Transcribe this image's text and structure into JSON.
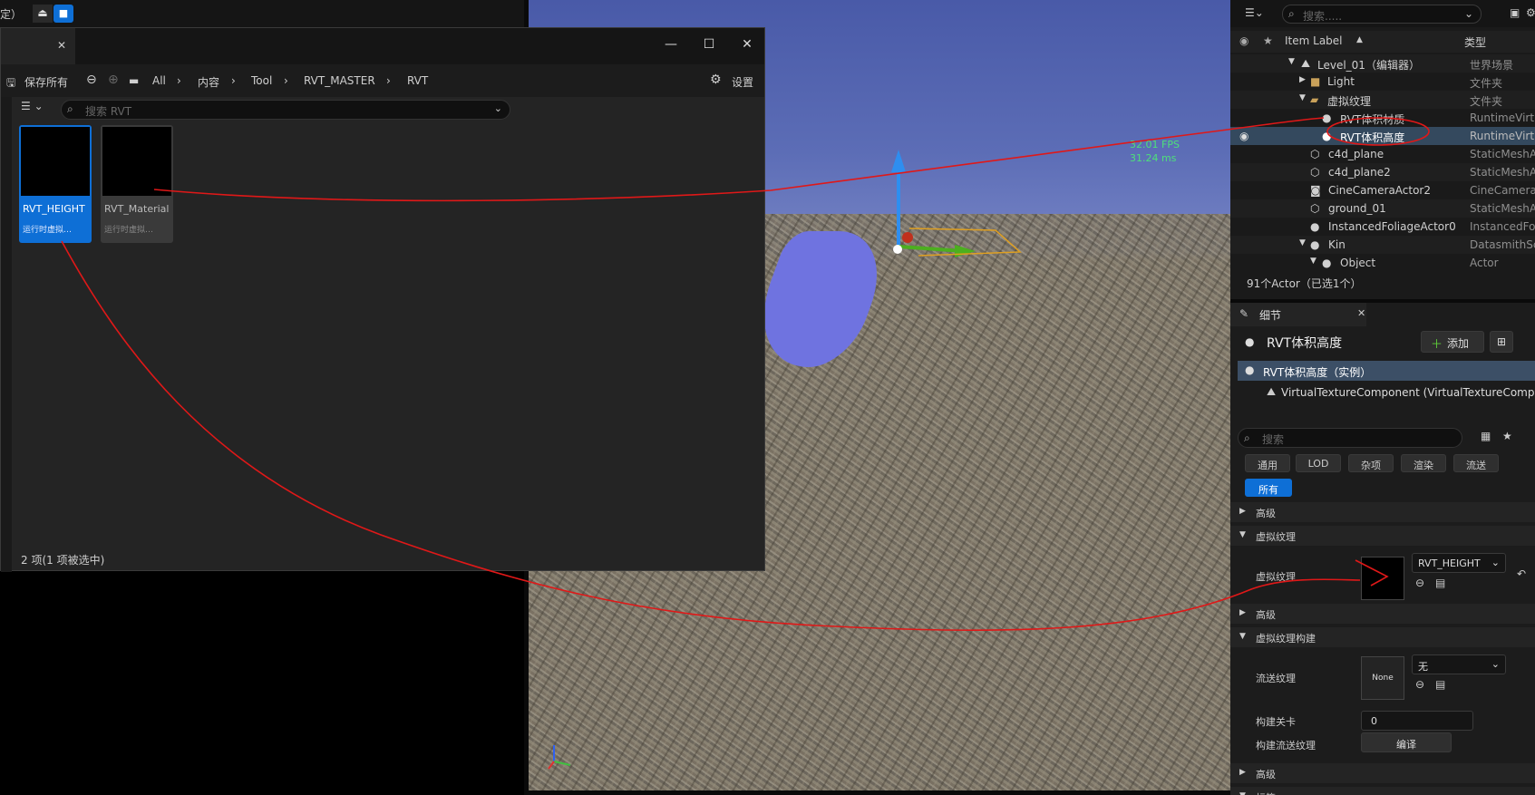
{
  "top_strip": {
    "label": "定）",
    "eject_icon": "eject-icon",
    "camera_icon": "video-camera-icon"
  },
  "viewport": {
    "fps": "32.01 FPS",
    "ms": "31.24 ms"
  },
  "content_browser": {
    "toolbar": {
      "save_all": "保存所有",
      "settings": "设置"
    },
    "breadcrumb": [
      "All",
      "内容",
      "Tool",
      "RVT_MASTER",
      "RVT"
    ],
    "search_placeholder": "搜索 RVT",
    "assets": [
      {
        "name": "RVT_HEIGHT",
        "type": "运行时虚拟…",
        "selected": true
      },
      {
        "name": "RVT_Material",
        "type": "运行时虚拟…",
        "selected": false
      }
    ],
    "status": "2 项(1 项被选中)"
  },
  "outliner": {
    "search_placeholder": "搜索.....",
    "col_label": "Item Label",
    "col_type": "类型",
    "rows": [
      {
        "label": "Level_01（编辑器）",
        "type": "世界场景"
      },
      {
        "label": "Light",
        "type": "文件夹"
      },
      {
        "label": "虚拟纹理",
        "type": "文件夹"
      },
      {
        "label": "RVT体积材质",
        "type": "RuntimeVirtu"
      },
      {
        "label": "RVT体积高度",
        "type": "RuntimeVirtu"
      },
      {
        "label": "c4d_plane",
        "type": "StaticMeshA"
      },
      {
        "label": "c4d_plane2",
        "type": "StaticMeshA"
      },
      {
        "label": "CineCameraActor2",
        "type": "CineCamera"
      },
      {
        "label": "ground_01",
        "type": "StaticMeshA"
      },
      {
        "label": "InstancedFoliageActor0",
        "type": "InstancedFo"
      },
      {
        "label": "Kin",
        "type": "DatasmithSc"
      },
      {
        "label": "Object_",
        "type": "Actor"
      }
    ],
    "count": "91个Actor（已选1个）"
  },
  "details": {
    "tab": "细节",
    "title": "RVT体积高度",
    "add": "添加",
    "instance": "RVT体积高度（实例）",
    "component": "VirtualTextureComponent (VirtualTextureComp",
    "search_placeholder": "搜索",
    "filters": [
      "通用",
      "LOD",
      "杂项",
      "渲染",
      "流送"
    ],
    "all": "所有",
    "sections": {
      "advanced": "高级",
      "vt": "虚拟纹理",
      "vt_build": "虚拟纹理构建",
      "tags": "标签"
    },
    "props": {
      "vt": "虚拟纹理",
      "vt_value": "RVT_HEIGHT",
      "stream": "流送纹理",
      "stream_value": "无",
      "none": "None",
      "build_level": "构建关卡",
      "build_level_value": "0",
      "build_stream": "构建流送纹理",
      "compile": "编译"
    }
  }
}
